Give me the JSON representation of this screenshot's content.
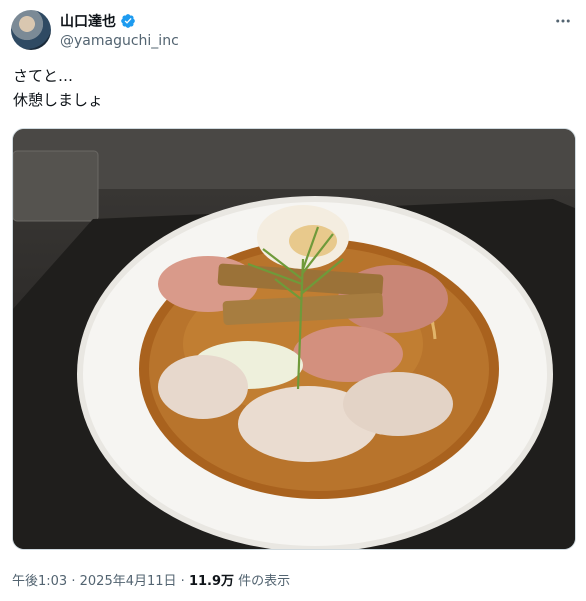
{
  "author": {
    "display_name": "山口達也",
    "handle": "@yamaguchi_inc",
    "verified_icon": "verified-badge-icon",
    "verified_color": "#1d9bf0"
  },
  "post": {
    "lines": [
      "さてと…",
      "休憩しましょ"
    ],
    "image_icon": "ramen-bowl-photo"
  },
  "footer": {
    "time": "午後1:03",
    "sep": "·",
    "date": "2025年4月11日",
    "views_count": "11.9万",
    "views_label": "件の表示"
  },
  "menu": {
    "icon": "more-options-icon"
  }
}
